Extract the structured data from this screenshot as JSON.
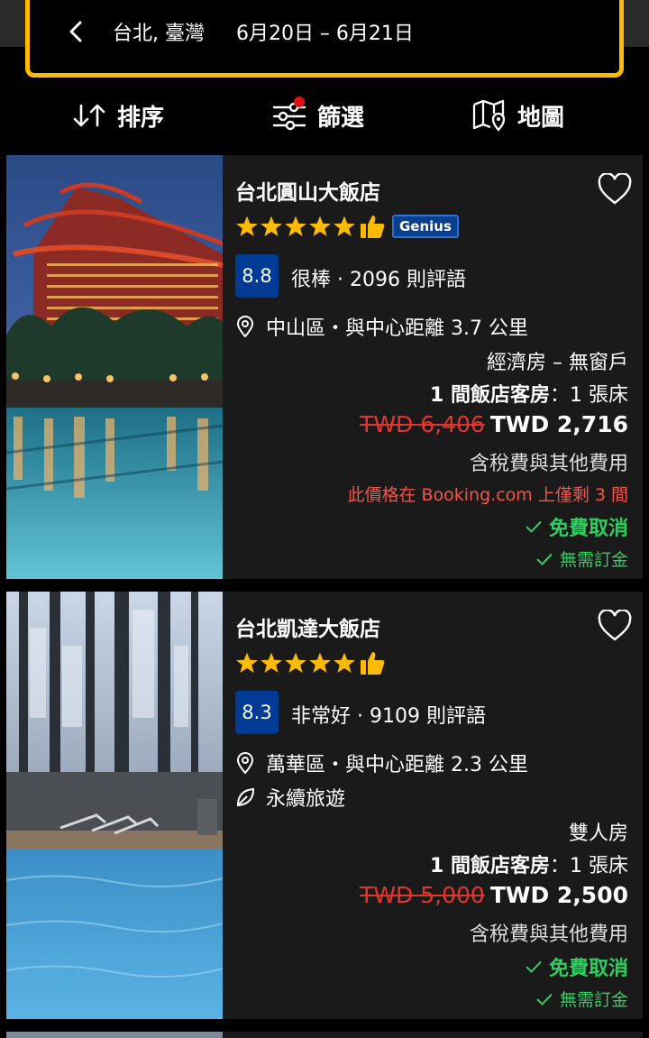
{
  "search": {
    "text": "台北, 臺灣     6月20日 – 6月21日"
  },
  "toolbar": {
    "sort_label": "排序",
    "filter_label": "篩選",
    "map_label": "地圖"
  },
  "colors": {
    "accent_yellow": "#febb02",
    "score_blue": "#003b95",
    "old_price_red": "#e3352c",
    "free_cancel_green": "#2fce62",
    "star_yellow": "#febb02"
  },
  "hotels": [
    {
      "name": "台北圓山大飯店",
      "stars": 5,
      "genius": "Genius",
      "score": "8.8",
      "review_summary": "很棒 · 2096 則評語",
      "location": "中山區・與中心距離 3.7 公里",
      "room_type": "經濟房 – 無窗戶",
      "room_count_bold": "1 間飯店客房",
      "room_count_rest": "：1 張床",
      "old_price": "TWD 6,406",
      "new_price": "TWD 2,716",
      "taxes": "含稅費與其他費用",
      "scarcity": "此價格在 Booking.com 上僅剩 3 間",
      "free_cancel": "免費取消",
      "no_prepay": "無需訂金"
    },
    {
      "name": "台北凱達大飯店",
      "stars": 5,
      "score": "8.3",
      "review_summary": "非常好 · 9109 則評語",
      "location": "萬華區・與中心距離 2.3 公里",
      "sustainable": "永續旅遊",
      "room_type": "雙人房",
      "room_count_bold": "1 間飯店客房",
      "room_count_rest": "：1 張床",
      "old_price": "TWD 5,000",
      "new_price": "TWD 2,500",
      "taxes": "含稅費與其他費用",
      "free_cancel": "免費取消",
      "no_prepay": "無需訂金"
    }
  ]
}
